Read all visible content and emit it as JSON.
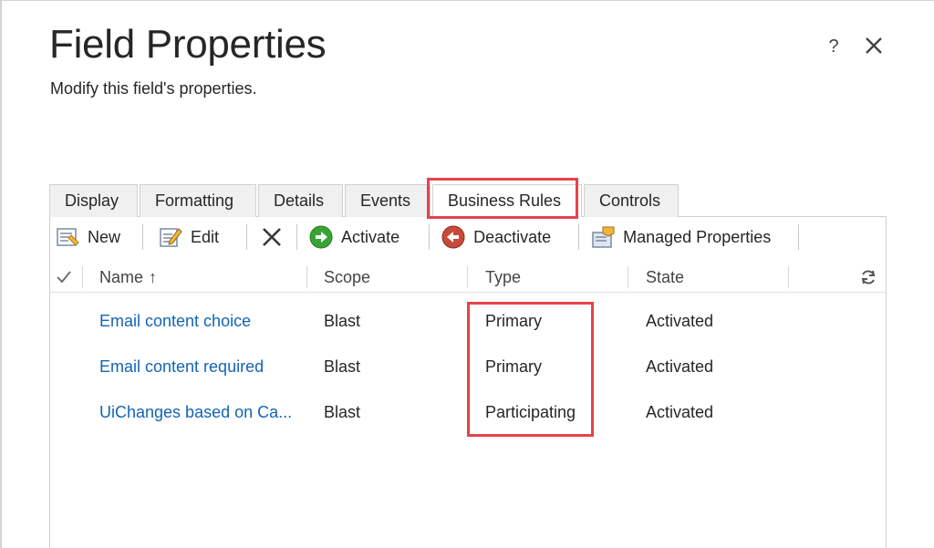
{
  "dialog": {
    "title": "Field Properties",
    "subtitle": "Modify this field's properties.",
    "help_label": "?"
  },
  "tabs": [
    {
      "label": "Display"
    },
    {
      "label": "Formatting"
    },
    {
      "label": "Details"
    },
    {
      "label": "Events"
    },
    {
      "label": "Business Rules",
      "selected": true
    },
    {
      "label": "Controls"
    }
  ],
  "toolbar": {
    "new_label": "New",
    "edit_label": "Edit",
    "activate_label": "Activate",
    "deactivate_label": "Deactivate",
    "managed_label": "Managed Properties"
  },
  "grid": {
    "columns": {
      "name": "Name",
      "sort_indicator": "↑",
      "scope": "Scope",
      "type": "Type",
      "state": "State"
    },
    "rows": [
      {
        "name": "Email content choice",
        "scope": "Blast",
        "type": "Primary",
        "state": "Activated"
      },
      {
        "name": "Email content required",
        "scope": "Blast",
        "type": "Primary",
        "state": "Activated"
      },
      {
        "name": "UiChanges based on Ca...",
        "scope": "Blast",
        "type": "Participating",
        "state": "Activated"
      }
    ]
  },
  "colors": {
    "highlight": "#e8424b",
    "link": "#1464b4",
    "activate_green": "#3aa335",
    "deactivate_red": "#c0392b"
  },
  "icons": [
    "new-rule-icon",
    "edit-icon",
    "delete-icon",
    "activate-icon",
    "deactivate-icon",
    "managed-properties-icon",
    "checkmark-icon",
    "refresh-icon",
    "close-icon"
  ]
}
